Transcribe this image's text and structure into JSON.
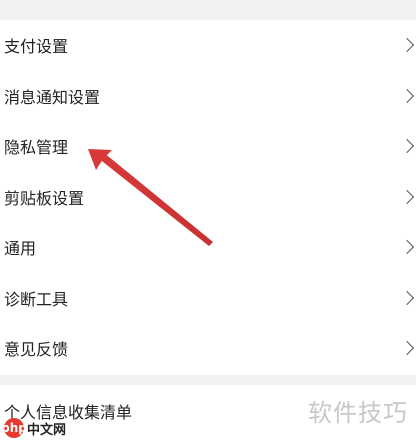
{
  "settings": {
    "items": [
      {
        "label": "支付设置"
      },
      {
        "label": "消息通知设置"
      },
      {
        "label": "隐私管理"
      },
      {
        "label": "剪贴板设置"
      },
      {
        "label": "通用"
      },
      {
        "label": "诊断工具"
      },
      {
        "label": "意见反馈"
      }
    ],
    "bottom_item": {
      "label": "个人信息收集清单"
    }
  },
  "watermark": {
    "text": "软件技巧",
    "logo_text": "php",
    "logo_suffix": "中文网"
  },
  "colors": {
    "arrow": "#d83a3a",
    "background": "#f2f2f2",
    "row_bg": "#ffffff"
  }
}
